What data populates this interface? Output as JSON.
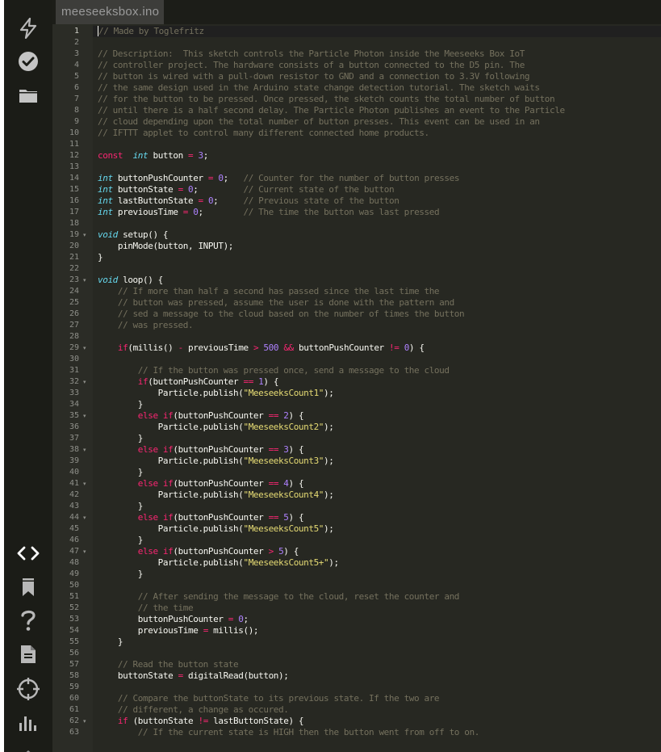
{
  "editor": {
    "tab_title": "meeseeksbox.ino"
  },
  "sidebar": {
    "top_icons": [
      "flash-icon",
      "verify-check-icon",
      "folder-icon"
    ],
    "bottom_icons": [
      "code-icon",
      "bookmark-icon",
      "help-icon",
      "document-icon",
      "target-icon",
      "bar-chart-icon"
    ]
  },
  "theme": {
    "background": "#272822",
    "comment": "#75715e",
    "keyword": "#f92672",
    "type": "#66d9ef",
    "number": "#ae81ff",
    "string": "#e6db74",
    "text": "#f8f8f2"
  },
  "code_lines": [
    [
      [
        "cm",
        "// Made by Toglefritz"
      ]
    ],
    [],
    [
      [
        "cm",
        "// Description:  This sketch controls the Particle Photon inside the Meeseeks Box IoT"
      ]
    ],
    [
      [
        "cm",
        "// controller project. The hardware consists of a button connected to the D5 pin. The"
      ]
    ],
    [
      [
        "cm",
        "// button is wired with a pull-down resistor to GND and a connection to 3.3V following"
      ]
    ],
    [
      [
        "cm",
        "// the same design used in the Arduino state change detection tutorial. The sketch waits"
      ]
    ],
    [
      [
        "cm",
        "// for the button to be pressed. Once pressed, the sketch counts the total number of button"
      ]
    ],
    [
      [
        "cm",
        "// until there is a half second delay. The Particle Photon publishes an event to the Particle"
      ]
    ],
    [
      [
        "cm",
        "// cloud depending upon the total number of button presses. This event can be used in an"
      ]
    ],
    [
      [
        "cm",
        "// IFTTT applet to control many different connected home products."
      ]
    ],
    [],
    [
      [
        "kw",
        "const"
      ],
      [
        "",
        "  "
      ],
      [
        "ty",
        "int"
      ],
      [
        "",
        " button "
      ],
      [
        "op",
        "="
      ],
      [
        "",
        " "
      ],
      [
        "nm",
        "3"
      ],
      [
        "",
        ";"
      ]
    ],
    [],
    [
      [
        "ty",
        "int"
      ],
      [
        "",
        " buttonPushCounter "
      ],
      [
        "op",
        "="
      ],
      [
        "",
        " "
      ],
      [
        "nm",
        "0"
      ],
      [
        "",
        ";   "
      ],
      [
        "cm",
        "// Counter for the number of button presses"
      ]
    ],
    [
      [
        "ty",
        "int"
      ],
      [
        "",
        " buttonState "
      ],
      [
        "op",
        "="
      ],
      [
        "",
        " "
      ],
      [
        "nm",
        "0"
      ],
      [
        "",
        ";         "
      ],
      [
        "cm",
        "// Current state of the button"
      ]
    ],
    [
      [
        "ty",
        "int"
      ],
      [
        "",
        " lastButtonState "
      ],
      [
        "op",
        "="
      ],
      [
        "",
        " "
      ],
      [
        "nm",
        "0"
      ],
      [
        "",
        ";     "
      ],
      [
        "cm",
        "// Previous state of the button"
      ]
    ],
    [
      [
        "ty",
        "int"
      ],
      [
        "",
        " previousTime "
      ],
      [
        "op",
        "="
      ],
      [
        "",
        " "
      ],
      [
        "nm",
        "0"
      ],
      [
        "",
        ";        "
      ],
      [
        "cm",
        "// The time the button was last pressed"
      ]
    ],
    [],
    [
      [
        "ty",
        "void"
      ],
      [
        "",
        " setup() {"
      ]
    ],
    [
      [
        "",
        "    pinMode(button, INPUT);"
      ]
    ],
    [
      [
        "",
        "}"
      ]
    ],
    [],
    [
      [
        "ty",
        "void"
      ],
      [
        "",
        " loop() {"
      ]
    ],
    [
      [
        "",
        "    "
      ],
      [
        "cm",
        "// If more than half a second has passed since the last time the"
      ]
    ],
    [
      [
        "",
        "    "
      ],
      [
        "cm",
        "// button was pressed, assume the user is done with the pattern and"
      ]
    ],
    [
      [
        "",
        "    "
      ],
      [
        "cm",
        "// sed a message to the cloud based on the number of times the button"
      ]
    ],
    [
      [
        "",
        "    "
      ],
      [
        "cm",
        "// was pressed."
      ]
    ],
    [],
    [
      [
        "",
        "    "
      ],
      [
        "kw",
        "if"
      ],
      [
        "",
        "(millis() "
      ],
      [
        "op",
        "-"
      ],
      [
        "",
        " previousTime "
      ],
      [
        "op",
        ">"
      ],
      [
        "",
        " "
      ],
      [
        "nm",
        "500"
      ],
      [
        "",
        " "
      ],
      [
        "op",
        "&&"
      ],
      [
        "",
        " buttonPushCounter "
      ],
      [
        "op",
        "!="
      ],
      [
        "",
        " "
      ],
      [
        "nm",
        "0"
      ],
      [
        "",
        ") {"
      ]
    ],
    [],
    [
      [
        "",
        "        "
      ],
      [
        "cm",
        "// If the button was pressed once, send a message to the cloud"
      ]
    ],
    [
      [
        "",
        "        "
      ],
      [
        "kw",
        "if"
      ],
      [
        "",
        "(buttonPushCounter "
      ],
      [
        "op",
        "=="
      ],
      [
        "",
        " "
      ],
      [
        "nm",
        "1"
      ],
      [
        "",
        ") {"
      ]
    ],
    [
      [
        "",
        "            Particle.publish("
      ],
      [
        "st",
        "\"MeeseeksCount1\""
      ],
      [
        "",
        ");"
      ]
    ],
    [
      [
        "",
        "        }"
      ]
    ],
    [
      [
        "",
        "        "
      ],
      [
        "kw",
        "else"
      ],
      [
        "",
        " "
      ],
      [
        "kw",
        "if"
      ],
      [
        "",
        "(buttonPushCounter "
      ],
      [
        "op",
        "=="
      ],
      [
        "",
        " "
      ],
      [
        "nm",
        "2"
      ],
      [
        "",
        ") {"
      ]
    ],
    [
      [
        "",
        "            Particle.publish("
      ],
      [
        "st",
        "\"MeeseeksCount2\""
      ],
      [
        "",
        ");"
      ]
    ],
    [
      [
        "",
        "        }"
      ]
    ],
    [
      [
        "",
        "        "
      ],
      [
        "kw",
        "else"
      ],
      [
        "",
        " "
      ],
      [
        "kw",
        "if"
      ],
      [
        "",
        "(buttonPushCounter "
      ],
      [
        "op",
        "=="
      ],
      [
        "",
        " "
      ],
      [
        "nm",
        "3"
      ],
      [
        "",
        ") {"
      ]
    ],
    [
      [
        "",
        "            Particle.publish("
      ],
      [
        "st",
        "\"MeeseeksCount3\""
      ],
      [
        "",
        ");"
      ]
    ],
    [
      [
        "",
        "        }"
      ]
    ],
    [
      [
        "",
        "        "
      ],
      [
        "kw",
        "else"
      ],
      [
        "",
        " "
      ],
      [
        "kw",
        "if"
      ],
      [
        "",
        "(buttonPushCounter "
      ],
      [
        "op",
        "=="
      ],
      [
        "",
        " "
      ],
      [
        "nm",
        "4"
      ],
      [
        "",
        ") {"
      ]
    ],
    [
      [
        "",
        "            Particle.publish("
      ],
      [
        "st",
        "\"MeeseeksCount4\""
      ],
      [
        "",
        ");"
      ]
    ],
    [
      [
        "",
        "        }"
      ]
    ],
    [
      [
        "",
        "        "
      ],
      [
        "kw",
        "else"
      ],
      [
        "",
        " "
      ],
      [
        "kw",
        "if"
      ],
      [
        "",
        "(buttonPushCounter "
      ],
      [
        "op",
        "=="
      ],
      [
        "",
        " "
      ],
      [
        "nm",
        "5"
      ],
      [
        "",
        ") {"
      ]
    ],
    [
      [
        "",
        "            Particle.publish("
      ],
      [
        "st",
        "\"MeeseeksCount5\""
      ],
      [
        "",
        ");"
      ]
    ],
    [
      [
        "",
        "        }"
      ]
    ],
    [
      [
        "",
        "        "
      ],
      [
        "kw",
        "else"
      ],
      [
        "",
        " "
      ],
      [
        "kw",
        "if"
      ],
      [
        "",
        "(buttonPushCounter "
      ],
      [
        "op",
        ">"
      ],
      [
        "",
        " "
      ],
      [
        "nm",
        "5"
      ],
      [
        "",
        ") {"
      ]
    ],
    [
      [
        "",
        "            Particle.publish("
      ],
      [
        "st",
        "\"MeeseeksCount5+\""
      ],
      [
        "",
        ");"
      ]
    ],
    [
      [
        "",
        "        }"
      ]
    ],
    [],
    [
      [
        "",
        "        "
      ],
      [
        "cm",
        "// After sending the message to the cloud, reset the counter and"
      ]
    ],
    [
      [
        "",
        "        "
      ],
      [
        "cm",
        "// the time"
      ]
    ],
    [
      [
        "",
        "        buttonPushCounter "
      ],
      [
        "op",
        "="
      ],
      [
        "",
        " "
      ],
      [
        "nm",
        "0"
      ],
      [
        "",
        ";"
      ]
    ],
    [
      [
        "",
        "        previousTime "
      ],
      [
        "op",
        "="
      ],
      [
        "",
        " millis();"
      ]
    ],
    [
      [
        "",
        "    }"
      ]
    ],
    [],
    [
      [
        "",
        "    "
      ],
      [
        "cm",
        "// Read the button state"
      ]
    ],
    [
      [
        "",
        "    buttonState "
      ],
      [
        "op",
        "="
      ],
      [
        "",
        " digitalRead(button);"
      ]
    ],
    [],
    [
      [
        "",
        "    "
      ],
      [
        "cm",
        "// Compare the buttonState to its previous state. If the two are"
      ]
    ],
    [
      [
        "",
        "    "
      ],
      [
        "cm",
        "// different, a change as occured."
      ]
    ],
    [
      [
        "",
        "    "
      ],
      [
        "kw",
        "if"
      ],
      [
        "",
        " (buttonState "
      ],
      [
        "op",
        "!="
      ],
      [
        "",
        " lastButtonState) {"
      ]
    ],
    [
      [
        "",
        "        "
      ],
      [
        "cm",
        "// If the current state is HIGH then the button went from off to on."
      ]
    ]
  ],
  "line_numbers": [
    "1",
    "2",
    "3",
    "4",
    "5",
    "6",
    "7",
    "8",
    "9",
    "10",
    "11",
    "12",
    "13",
    "14",
    "15",
    "16",
    "17",
    "18",
    "19",
    "20",
    "21",
    "22",
    "23",
    "24",
    "25",
    "26",
    "27",
    "28",
    "29",
    "30",
    "31",
    "32",
    "33",
    "34",
    "35",
    "36",
    "37",
    "38",
    "39",
    "40",
    "41",
    "42",
    "43",
    "44",
    "45",
    "46",
    "47",
    "48",
    "49",
    "50",
    "51",
    "52",
    "53",
    "54",
    "55",
    "56",
    "57",
    "58",
    "59",
    "60",
    "61",
    "62",
    "63"
  ],
  "fold_markers": [
    "19",
    "23",
    "29",
    "32",
    "35",
    "38",
    "41",
    "44",
    "47",
    "62"
  ],
  "active_line": "1"
}
